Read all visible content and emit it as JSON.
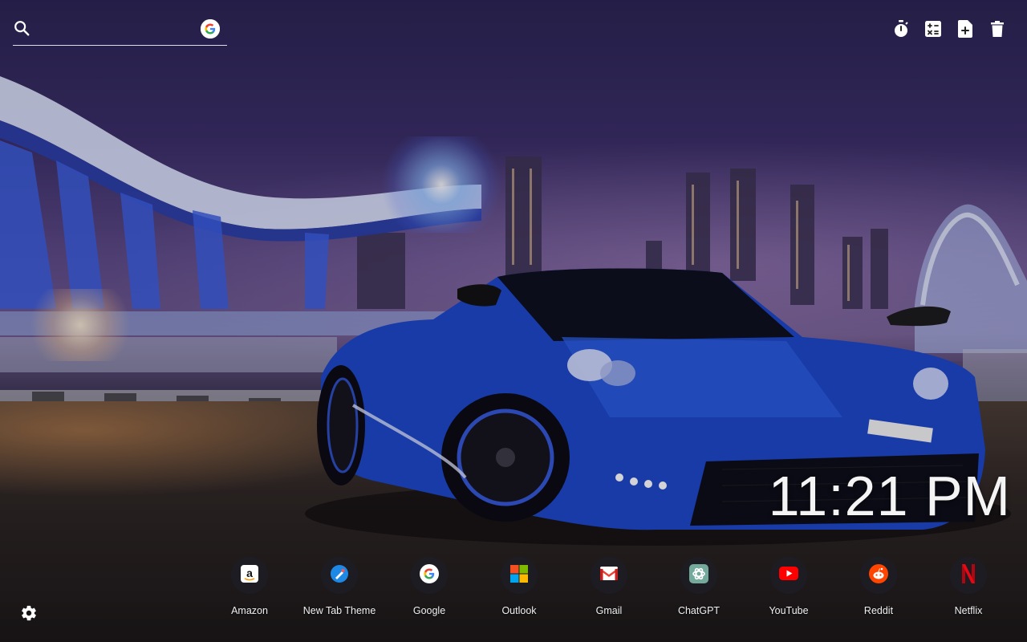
{
  "search": {
    "placeholder": "",
    "value": "",
    "engine_icon": "google-g-icon"
  },
  "toolbar": {
    "tools": [
      {
        "icon": "stopwatch-icon"
      },
      {
        "icon": "calculator-icon"
      },
      {
        "icon": "new-note-icon"
      },
      {
        "icon": "trash-icon"
      }
    ]
  },
  "clock": {
    "time": "11:21 PM"
  },
  "shortcuts": [
    {
      "label": "Amazon",
      "icon": "amazon-icon"
    },
    {
      "label": "New Tab Theme",
      "icon": "new-tab-theme-icon"
    },
    {
      "label": "Google",
      "icon": "google-icon"
    },
    {
      "label": "Outlook",
      "icon": "outlook-icon"
    },
    {
      "label": "Gmail",
      "icon": "gmail-icon"
    },
    {
      "label": "ChatGPT",
      "icon": "chatgpt-icon"
    },
    {
      "label": "YouTube",
      "icon": "youtube-icon"
    },
    {
      "label": "Reddit",
      "icon": "reddit-icon"
    },
    {
      "label": "Netflix",
      "icon": "netflix-icon"
    }
  ],
  "settings": {
    "icon": "gear-icon"
  },
  "colors": {
    "accent_blue": "#1a4fd6",
    "overlay": "#1e1e26",
    "text": "#ffffff"
  }
}
